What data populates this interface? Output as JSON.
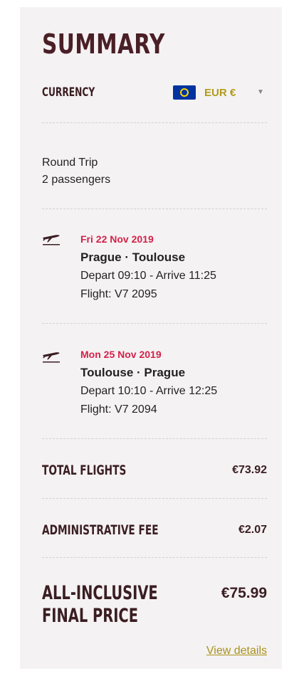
{
  "summary": {
    "title": "SUMMARY"
  },
  "currency": {
    "label": "CURRENCY",
    "value": "EUR €",
    "flag_icon": "eu-flag-icon",
    "chevron_icon": "chevron-down-icon",
    "accent_color": "#b09b1a"
  },
  "trip": {
    "type": "Round Trip",
    "passengers": "2 passengers"
  },
  "flights": [
    {
      "icon": "plane-takeoff-icon",
      "date": "Fri 22 Nov 2019",
      "route": "Prague · Toulouse",
      "times": "Depart 09:10 - Arrive 11:25",
      "flight": "Flight: V7 2095"
    },
    {
      "icon": "plane-takeoff-icon",
      "date": "Mon 25 Nov 2019",
      "route": "Toulouse · Prague",
      "times": "Depart 10:10 - Arrive 12:25",
      "flight": "Flight: V7 2094"
    }
  ],
  "totals": {
    "flights_label": "TOTAL FLIGHTS",
    "flights_value": "€73.92",
    "fee_label": "ADMINISTRATIVE FEE",
    "fee_value": "€2.07",
    "final_label_1": "ALL-INCLUSIVE",
    "final_label_2": "FINAL PRICE",
    "final_value": "€75.99"
  },
  "links": {
    "view_details": "View details"
  },
  "colors": {
    "date_accent": "#d3224a",
    "title": "#4a1f26",
    "panel_bg": "#f5f2f3"
  }
}
